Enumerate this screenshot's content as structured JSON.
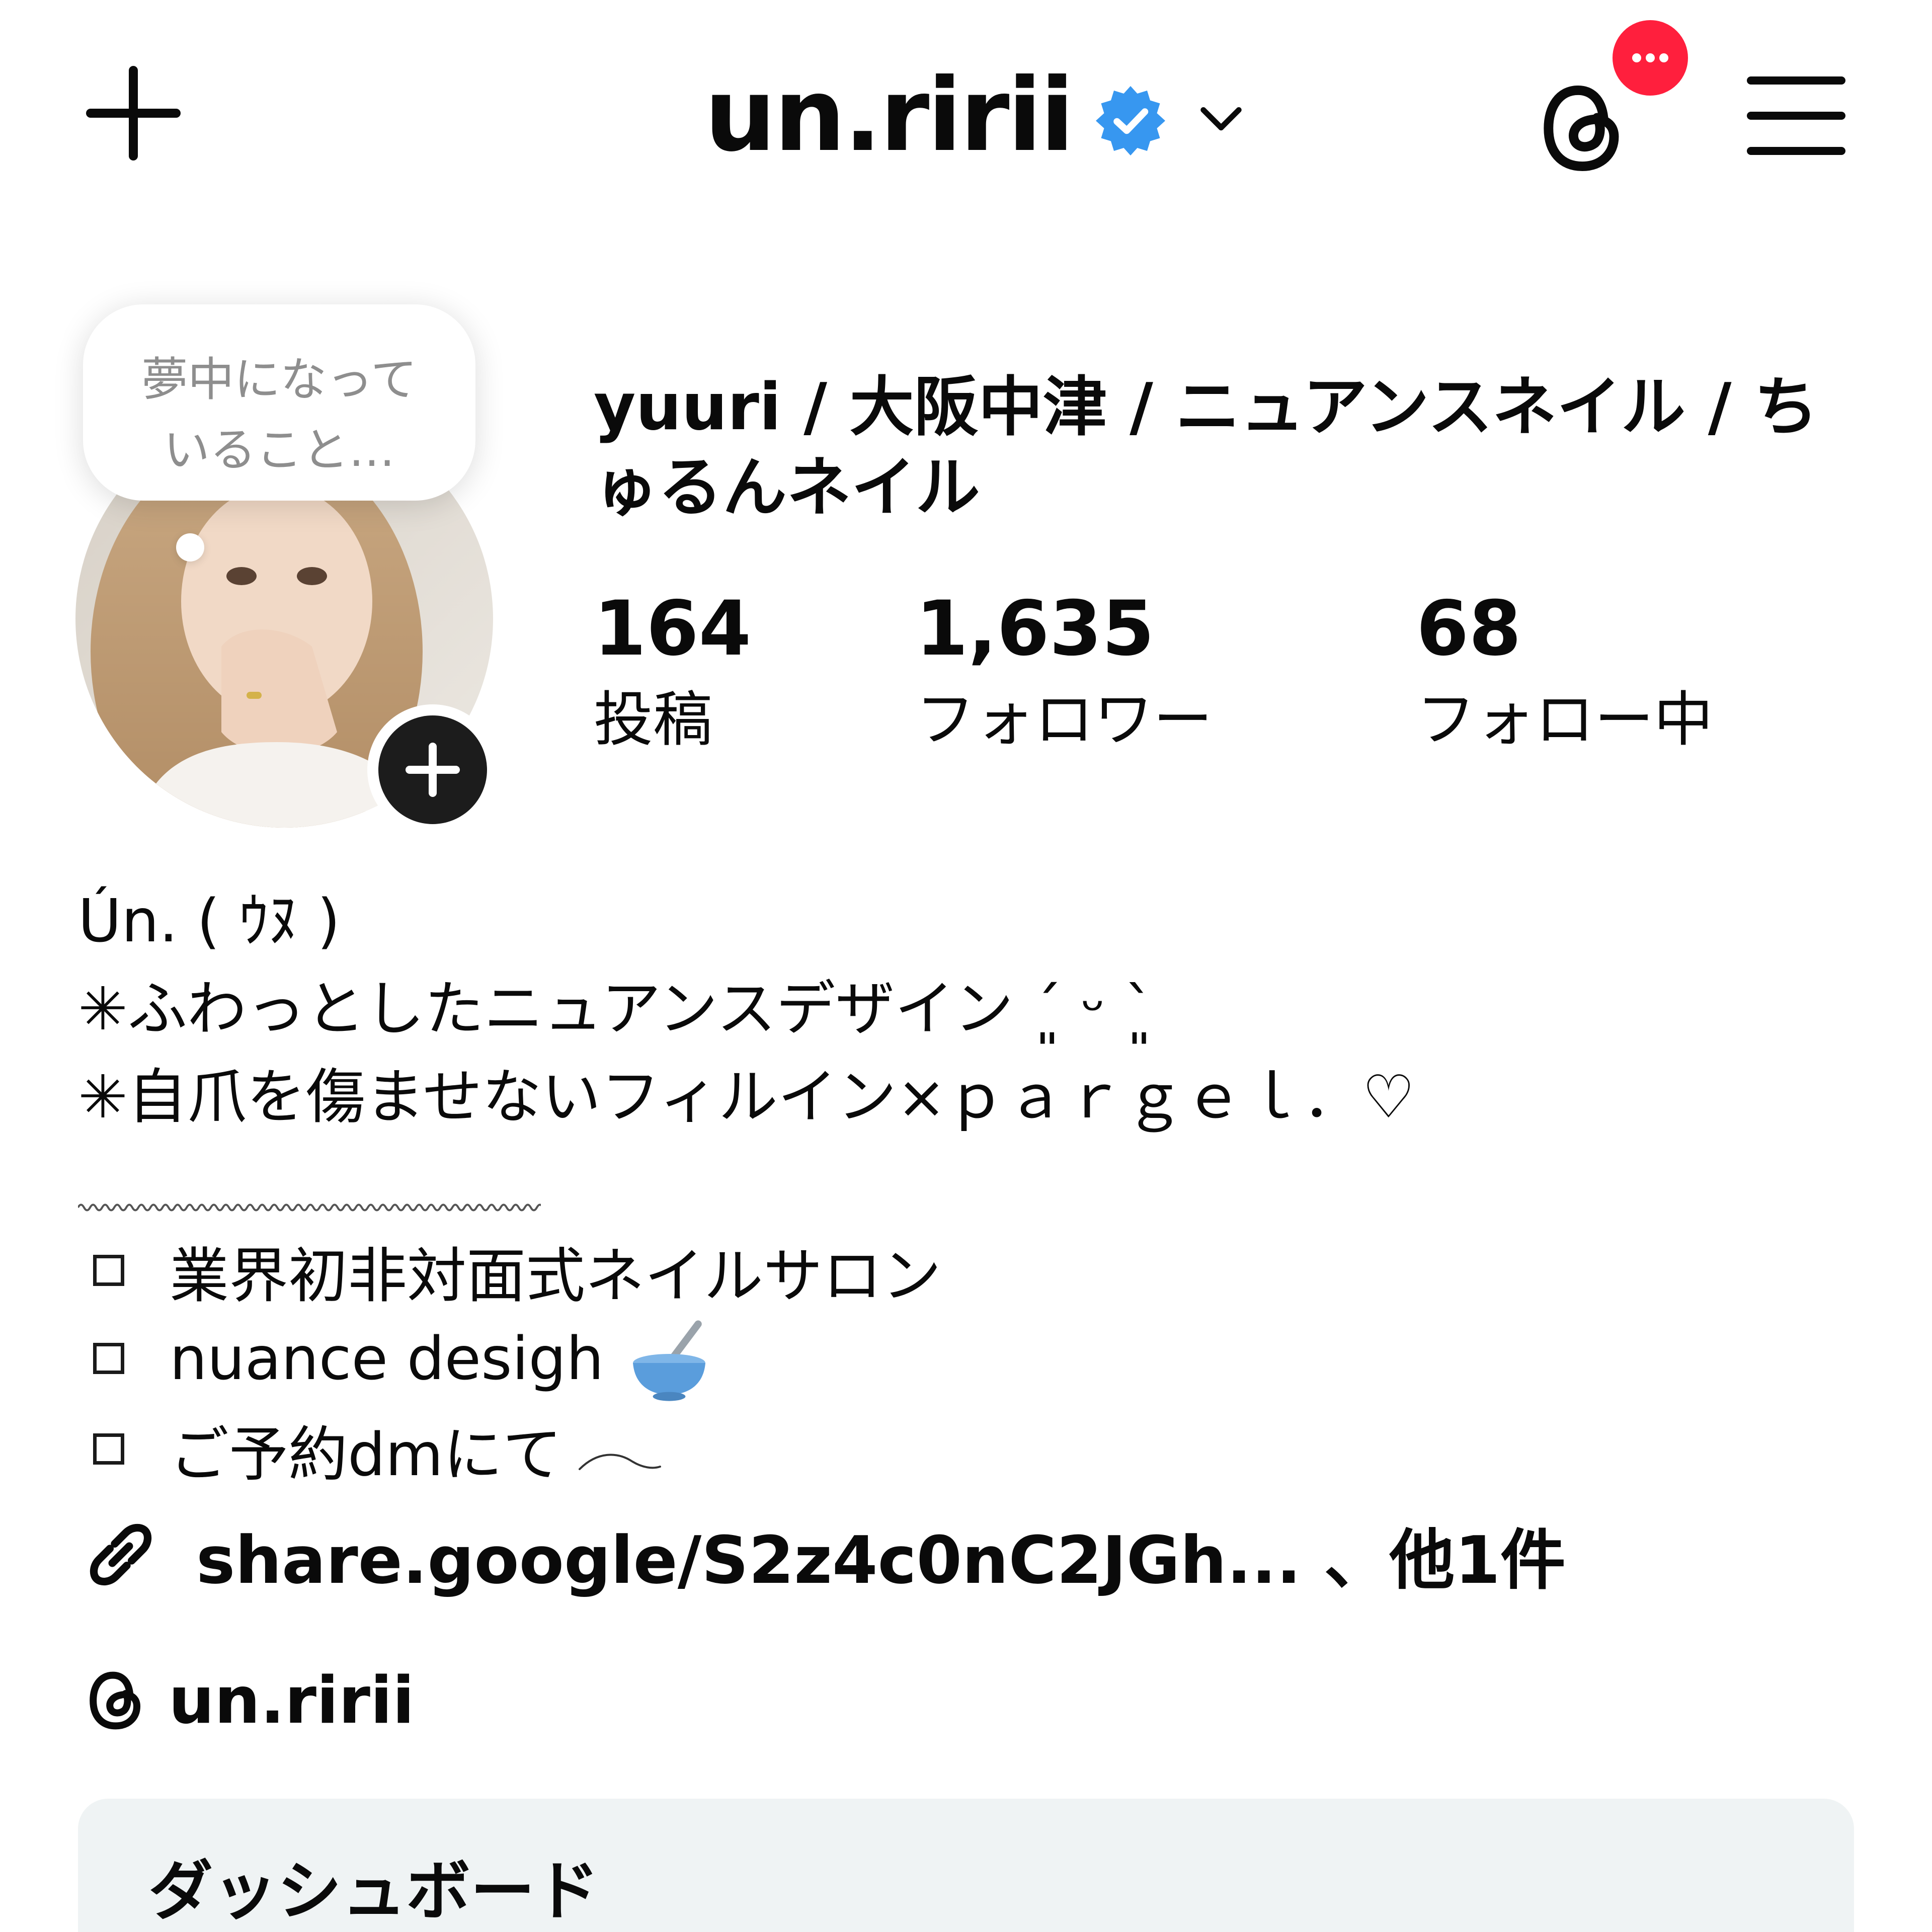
{
  "header": {
    "username": "un.ririi",
    "verified": true,
    "verified_color": "#3797f0",
    "notification_badge_color": "#ff1f3d",
    "icons": [
      "plus-icon",
      "verified-badge-icon",
      "chevron-down-icon",
      "threads-icon",
      "more-dots-icon",
      "hamburger-menu-icon"
    ]
  },
  "note": {
    "text": "夢中になって\nいること…"
  },
  "profile": {
    "display_name": "yuuri / 大阪中津 / ニュアンスネイル / ちゅるんネイル",
    "stats": {
      "posts": {
        "value": "164",
        "label": "投稿"
      },
      "followers": {
        "value": "1,635",
        "label": "フォロワー"
      },
      "following": {
        "value": "68",
        "label": "フォロー中"
      }
    }
  },
  "bio": {
    "line1": "Ún. ( ｳﾇ )",
    "line2": "✳︎ふわっとしたニュアンスデザイン ´͈ ᵕ `͈",
    "line3": "✳︎自爪を傷ませないフィルイン×ｐａｒｇｅｌ．♡",
    "items": [
      {
        "text": "業界初非対面式ネイルサロン",
        "icon": ""
      },
      {
        "text": "nuance desigh",
        "icon": "bowl-emoji-icon"
      },
      {
        "text": "ご予約dmにて",
        "icon": "tilde-icon"
      }
    ]
  },
  "link": {
    "text": "share.google/S2z4c0nC2JGh... 、他1件",
    "icon": "link-icon"
  },
  "threads": {
    "handle": "un.ririi",
    "icon": "threads-icon"
  },
  "dashboard": {
    "title": "ダッシュボード"
  }
}
